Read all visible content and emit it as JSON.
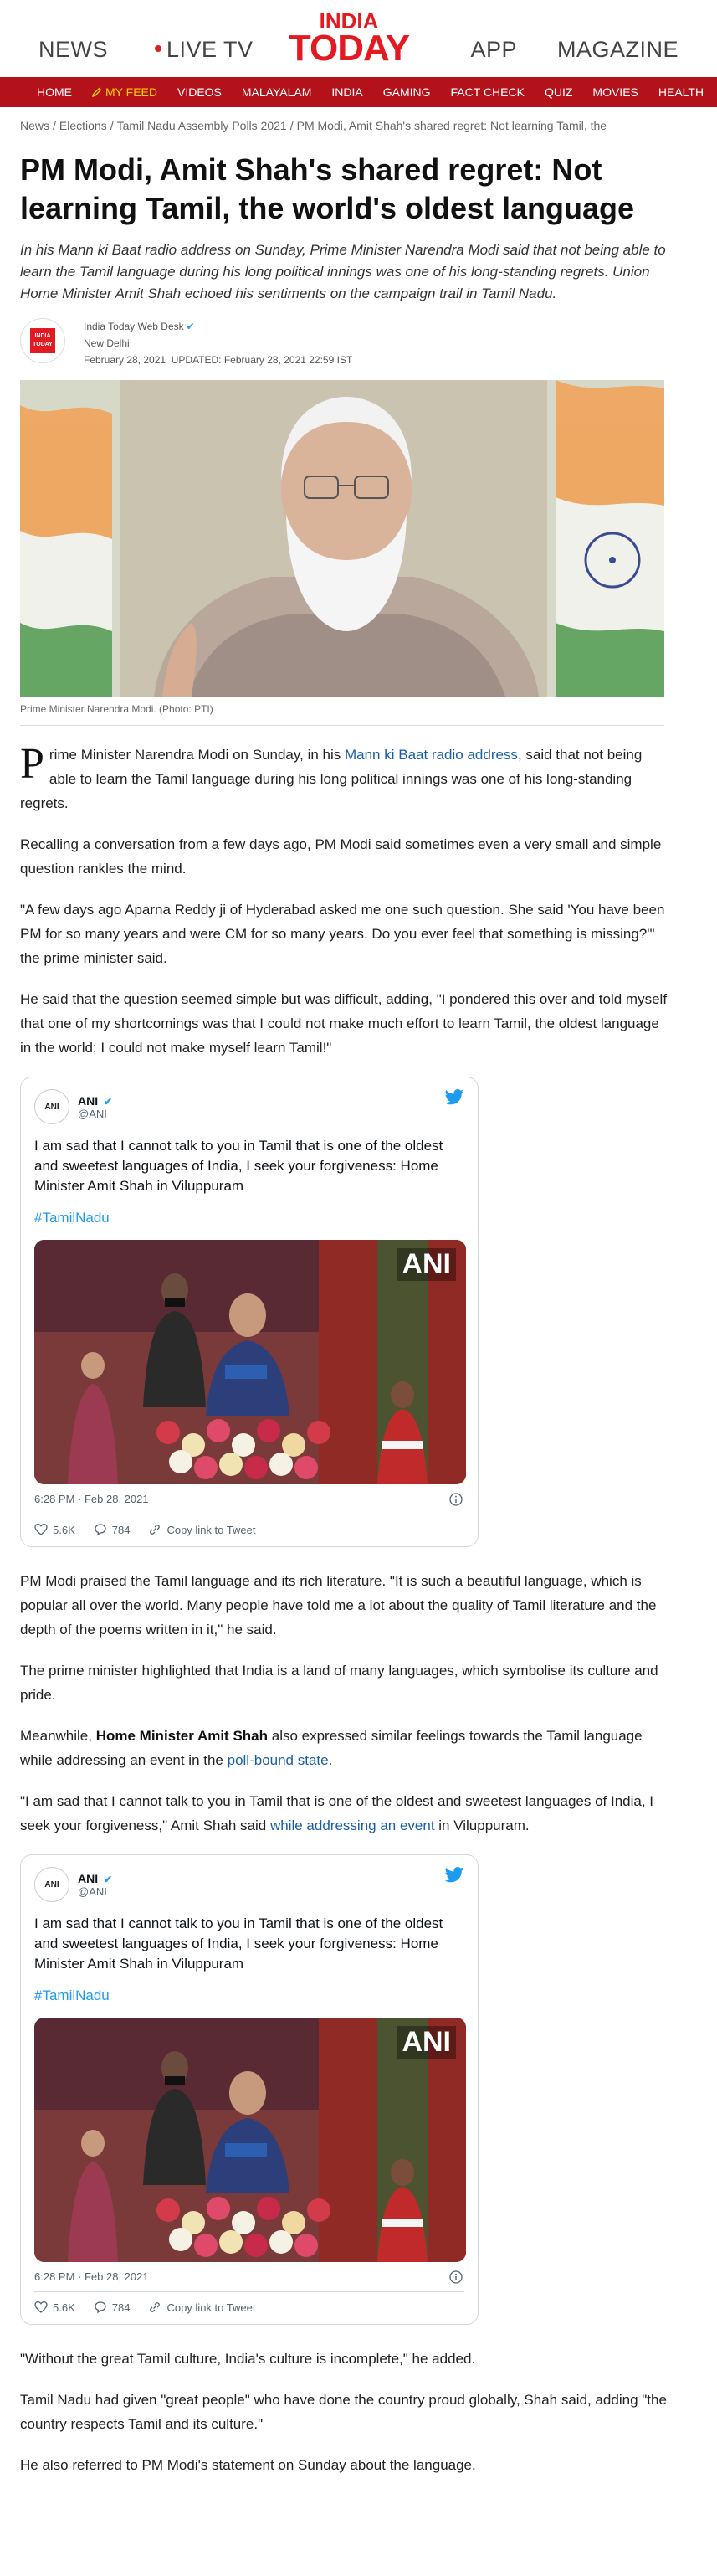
{
  "header": {
    "left_links": [
      "NEWS",
      "LIVE TV"
    ],
    "logo_line1": "INDIA",
    "logo_line2": "TODAY",
    "right_links": [
      "APP",
      "MAGAZINE"
    ]
  },
  "rednav": [
    "HOME",
    "MY FEED",
    "VIDEOS",
    "MALAYALAM",
    "INDIA",
    "GAMING",
    "FACT CHECK",
    "QUIZ",
    "MOVIES",
    "HEALTH"
  ],
  "breadcrumb": [
    "News",
    "Elections",
    "Tamil Nadu Assembly Polls 2021",
    "PM Modi, Amit Shah's shared regret: Not learning Tamil, the"
  ],
  "article": {
    "title": "PM Modi, Amit Shah's shared regret: Not learning Tamil, the world's oldest language",
    "summary": "In his Mann ki Baat radio address on Sunday, Prime Minister Narendra Modi said that not being able to learn the Tamil language during his long political innings was one of his long-standing regrets. Union Home Minister Amit Shah echoed his sentiments on the campaign trail in Tamil Nadu.",
    "author": "India Today Web Desk",
    "location": "New Delhi",
    "date": "February 28, 2021",
    "updated": "UPDATED: February 28, 2021 22:59 IST",
    "image_caption": "Prime Minister Narendra Modi. (Photo: PTI)",
    "p1_cap": "P",
    "p1_a": "rime Minister Narendra Modi on Sunday, in his ",
    "p1_link": "Mann ki Baat radio address",
    "p1_b": ", said that not being able to learn the Tamil language during his long political innings was one of his long-standing regrets.",
    "p2": "Recalling a conversation from a few days ago, PM Modi said sometimes even a very small and simple question rankles the mind.",
    "p3": "\"A few days ago Aparna Reddy ji of Hyderabad asked me one such question. She said 'You have been PM for so many years and were CM for so many years. Do you ever feel that something is missing?'\" the prime minister said.",
    "p4": "He said that the question seemed simple but was difficult, adding, \"I pondered this over and told myself that one of my shortcomings was that I could not make much effort to learn Tamil, the oldest language in the world; I could not make myself learn Tamil!\"",
    "p5": "PM Modi praised the Tamil language and its rich literature. \"It is such a beautiful language, which is popular all over the world. Many people have told me a lot about the quality of Tamil literature and the depth of the poems written in it,\" he said.",
    "p6": "The prime minister highlighted that India is a land of many languages, which symbolise its culture and pride.",
    "p7_a": "Meanwhile, ",
    "p7_bold": "Home Minister Amit Shah",
    "p7_b": " also expressed similar feelings towards the Tamil language while addressing an event in the ",
    "p7_link": "poll-bound state",
    "p7_c": ".",
    "p8_a": "\"I am sad that I cannot talk to you in Tamil that is one of the oldest and sweetest languages of India, I seek your forgiveness,\" Amit Shah said ",
    "p8_link": "while addressing an event",
    "p8_b": " in Viluppuram.",
    "p9": "\"Without the great Tamil culture, India's culture is incomplete,\" he added.",
    "p10": "Tamil Nadu had given \"great people\" who have done the country proud globally, Shah said, adding \"the country respects Tamil and its culture.\"",
    "p11": "He also referred to PM Modi's statement on Sunday about the language."
  },
  "tweet": {
    "avatar_text": "ANI",
    "name": "ANI",
    "handle": "@ANI",
    "text": "I am sad that I cannot talk to you in Tamil that is one of the oldest and sweetest languages of India, I seek your forgiveness: Home Minister Amit Shah in Viluppuram",
    "hashtag": "#TamilNadu",
    "watermark": "ANI",
    "time": "6:28 PM · Feb 28, 2021",
    "likes": "5.6K",
    "replies": "784",
    "copy_link": "Copy link to Tweet"
  },
  "colors": {
    "brand_red": "#e21b22",
    "nav_red": "#b4121b",
    "feed_yellow": "#ffd200",
    "link_blue": "#1a5fa6",
    "twitter_blue": "#1d9bf0"
  }
}
